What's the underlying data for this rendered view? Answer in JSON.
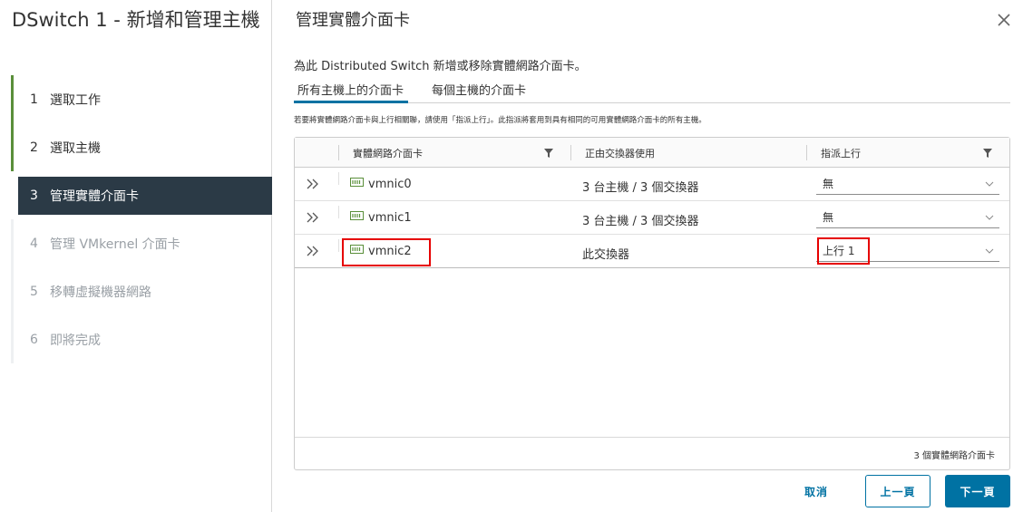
{
  "wizard": {
    "title": "DSwitch 1 - 新增和管理主機",
    "steps": [
      {
        "num": "1",
        "label": "選取工作",
        "state": "done"
      },
      {
        "num": "2",
        "label": "選取主機",
        "state": "done"
      },
      {
        "num": "3",
        "label": "管理實體介面卡",
        "state": "active"
      },
      {
        "num": "4",
        "label": "管理 VMkernel 介面卡",
        "state": "pending"
      },
      {
        "num": "5",
        "label": "移轉虛擬機器網路",
        "state": "pending"
      },
      {
        "num": "6",
        "label": "即將完成",
        "state": "pending"
      }
    ]
  },
  "page": {
    "title": "管理實體介面卡",
    "description": "為此 Distributed Switch 新增或移除實體網路介面卡。",
    "hint": "若要將實體網路介面卡與上行相關聯，請使用「指派上行」。此指派將套用到具有相同的可用實體網路介面卡的所有主機。"
  },
  "tabs": [
    {
      "label": "所有主機上的介面卡",
      "active": true
    },
    {
      "label": "每個主機的介面卡",
      "active": false
    }
  ],
  "grid": {
    "columns": {
      "nic": "實體網路介面卡",
      "in_use": "正由交換器使用",
      "uplink": "指派上行"
    },
    "rows": [
      {
        "nic": "vmnic0",
        "in_use": "3 台主機 / 3 個交換器",
        "uplink": "無"
      },
      {
        "nic": "vmnic1",
        "in_use": "3 台主機 / 3 個交換器",
        "uplink": "無"
      },
      {
        "nic": "vmnic2",
        "in_use": "此交換器",
        "uplink": "上行 1"
      }
    ],
    "footer": "3 個實體網路介面卡"
  },
  "buttons": {
    "cancel": "取消",
    "back": "上一頁",
    "next": "下一頁"
  },
  "colors": {
    "accent": "#0072a3",
    "active_step_bg": "#2b3a46",
    "done_step_bar": "#5a8f3a",
    "highlight": "#e60000",
    "nic_icon": "#5a8f3a"
  },
  "icons": {
    "close": "close-icon",
    "expand": "expand-icon",
    "filter": "filter-icon",
    "nic": "network-adapter-icon",
    "dropdown": "chevron-down-icon"
  }
}
